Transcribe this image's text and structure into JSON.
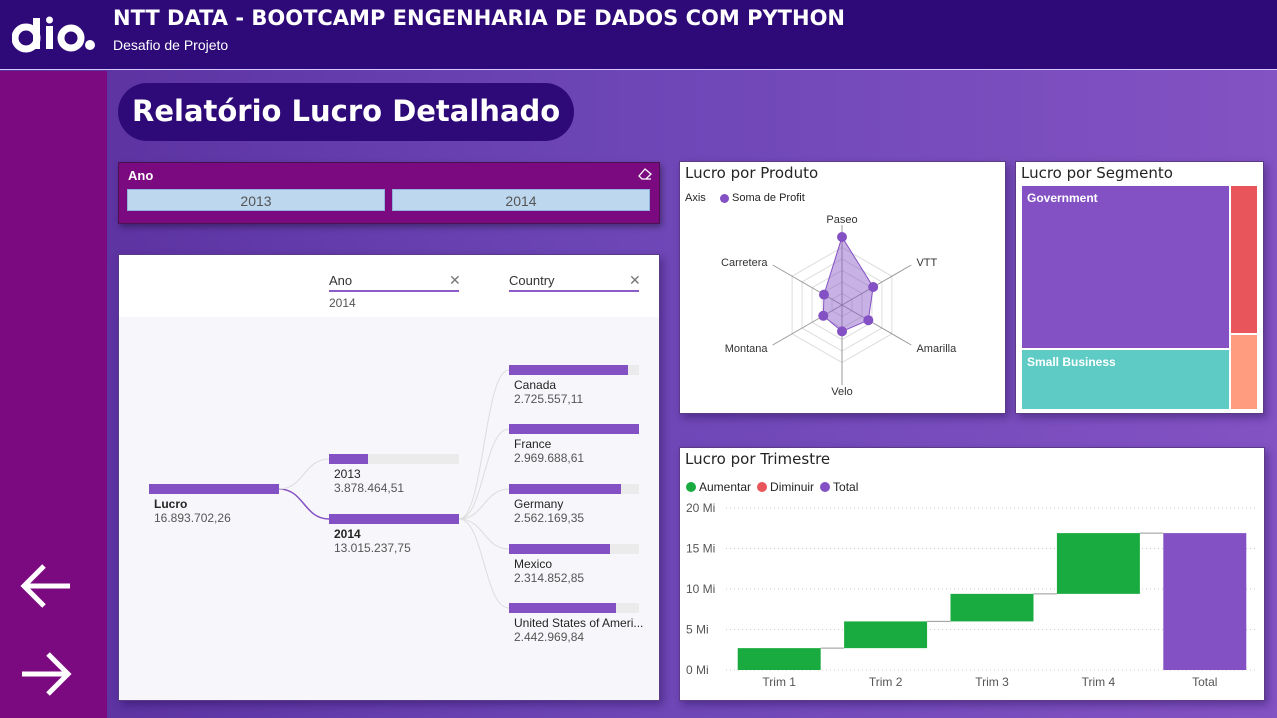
{
  "header": {
    "title": "NTT DATA - BOOTCAMP ENGENHARIA DE DADOS COM PYTHON",
    "subtitle": "Desafio de Projeto",
    "logo_text": "dio."
  },
  "page": {
    "title": "Relatório Lucro Detalhado"
  },
  "nav": {
    "back_icon": "arrow-left-icon",
    "forward_icon": "arrow-right-icon"
  },
  "slicer": {
    "label": "Ano",
    "options": [
      "2013",
      "2014"
    ],
    "erase_icon": "eraser-icon"
  },
  "decomposition": {
    "levels": [
      {
        "label": "Ano",
        "selected": "2014"
      },
      {
        "label": "Country",
        "selected": ""
      }
    ],
    "root": {
      "name": "Lucro",
      "value": "16.893.702,26"
    },
    "years": [
      {
        "name": "2013",
        "value": "3.878.464,51",
        "fraction": 0.298
      },
      {
        "name": "2014",
        "value": "13.015.237,75",
        "fraction": 1.0
      }
    ],
    "countries": [
      {
        "name": "Canada",
        "value": "2.725.557,11",
        "fraction": 0.918
      },
      {
        "name": "France",
        "value": "2.969.688,61",
        "fraction": 1.0
      },
      {
        "name": "Germany",
        "value": "2.562.169,35",
        "fraction": 0.863
      },
      {
        "name": "Mexico",
        "value": "2.314.852,85",
        "fraction": 0.78
      },
      {
        "name": "United States of Ameri...",
        "value": "2.442.969,84",
        "fraction": 0.823
      }
    ],
    "colors": {
      "bar": "#8451c4",
      "track": "#ebebeb"
    }
  },
  "radar": {
    "title": "Lucro por Produto",
    "legend_axis": "Axis",
    "legend_series": "Soma de Profit",
    "axes": [
      "Paseo",
      "VTT",
      "Amarilla",
      "Velo",
      "Montana",
      "Carretera"
    ],
    "values": [
      0.85,
      0.45,
      0.38,
      0.33,
      0.27,
      0.26
    ],
    "color": "#8451c4"
  },
  "treemap": {
    "title": "Lucro por Segmento",
    "segments": [
      {
        "name": "Government",
        "color": "#8451c4"
      },
      {
        "name": "Small Business",
        "color": "#5fcbc5"
      },
      {
        "name": "",
        "color": "#e8555a"
      },
      {
        "name": "",
        "color": "#ff9b7e"
      }
    ]
  },
  "waterfall": {
    "title": "Lucro por Trimestre",
    "legend": [
      {
        "label": "Aumentar",
        "color": "#1aab40"
      },
      {
        "label": "Diminuir",
        "color": "#e8555a"
      },
      {
        "label": "Total",
        "color": "#8451c4"
      }
    ]
  },
  "chart_data": {
    "type": "bar",
    "title": "Lucro por Trimestre",
    "categories": [
      "Trim 1",
      "Trim 2",
      "Trim 3",
      "Trim 4",
      "Total"
    ],
    "series": [
      {
        "name": "Aumentar",
        "start": [
          0,
          2.7,
          6.0,
          9.4
        ],
        "end": [
          2.7,
          6.0,
          9.4,
          16.9
        ]
      },
      {
        "name": "Total",
        "values": [
          16.9
        ]
      }
    ],
    "y_ticks": [
      "0 Mi",
      "5 Mi",
      "10 Mi",
      "15 Mi",
      "20 Mi"
    ],
    "ylim": [
      0,
      20
    ],
    "grid": true,
    "legend_position": "top-left"
  }
}
